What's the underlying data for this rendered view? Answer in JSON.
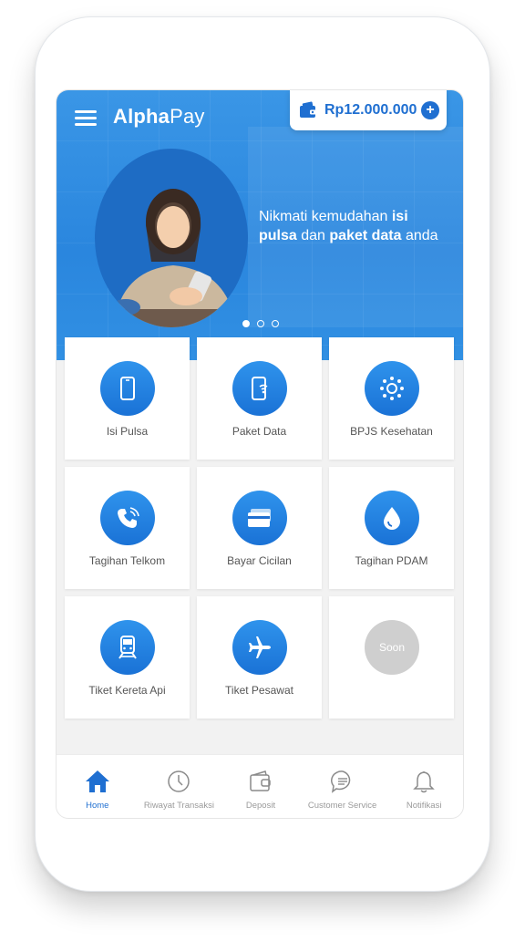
{
  "app": {
    "logo_main": "Alpha",
    "logo_thin": "Pay"
  },
  "balance": {
    "amount": "Rp12.000.000",
    "icon": "wallet-icon"
  },
  "banner": {
    "line1_pre": "Nikmati kemudahan ",
    "line1_bold": "isi",
    "line2_bold1": "pulsa",
    "line2_mid": " dan ",
    "line2_bold2": "paket data",
    "line2_post": " anda",
    "dots_total": 3,
    "dots_active": 1
  },
  "services": [
    {
      "label": "Isi Pulsa",
      "icon": "phone-icon"
    },
    {
      "label": "Paket Data",
      "icon": "phone-wifi-icon"
    },
    {
      "label": "BPJS Kesehatan",
      "icon": "bpjs-icon"
    },
    {
      "label": "Tagihan Telkom",
      "icon": "telephone-icon"
    },
    {
      "label": "Bayar Cicilan",
      "icon": "card-icon"
    },
    {
      "label": "Tagihan PDAM",
      "icon": "water-drop-icon"
    },
    {
      "label": "Tiket Kereta Api",
      "icon": "train-icon"
    },
    {
      "label": "Tiket Pesawat",
      "icon": "airplane-icon"
    },
    {
      "label": "Soon",
      "icon": "soon-placeholder"
    }
  ],
  "tabs": [
    {
      "label": "Home",
      "icon": "home-icon"
    },
    {
      "label": "Riwayat Transaksi",
      "icon": "clock-icon"
    },
    {
      "label": "Deposit",
      "icon": "wallet-icon"
    },
    {
      "label": "Customer Service",
      "icon": "chat-icon"
    },
    {
      "label": "Notifikasi",
      "icon": "bell-icon"
    }
  ],
  "colors": {
    "primary": "#1f6fd1",
    "hero": "#2a86de",
    "inactive": "#9a9a9a"
  }
}
